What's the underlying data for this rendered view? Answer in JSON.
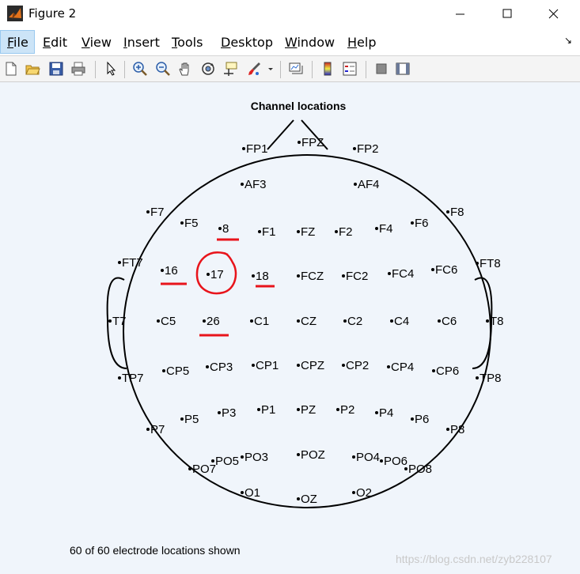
{
  "window": {
    "title": "Figure 2",
    "minimize_glyph": "—",
    "maximize_glyph": "☐",
    "close_glyph": "✕"
  },
  "menu": {
    "items": [
      "File",
      "Edit",
      "View",
      "Insert",
      "Tools",
      "Desktop",
      "Window",
      "Help"
    ],
    "undock_glyph": "↘"
  },
  "toolbar": {
    "icons": [
      "new-figure-icon",
      "open-file-icon",
      "save-icon",
      "print-icon",
      "select-arrow-icon",
      "zoom-in-icon",
      "zoom-out-icon",
      "pan-hand-icon",
      "rotate-3d-icon",
      "data-cursor-icon",
      "brush-icon",
      "brush-dropdown-icon",
      "link-plot-icon",
      "colorbar-icon",
      "legend-icon",
      "hide-plot-tools-icon",
      "show-plot-tools-icon"
    ]
  },
  "plot": {
    "title": "Channel locations",
    "footer": "60 of 60 electrode locations shown",
    "electrodes": [
      "FP1",
      "FPZ",
      "FP2",
      "AF3",
      "AF4",
      "F7",
      "F5",
      "8",
      "F1",
      "FZ",
      "F2",
      "F4",
      "F6",
      "F8",
      "FT7",
      "16",
      "17",
      "18",
      "FCZ",
      "FC2",
      "FC4",
      "FC6",
      "FT8",
      "T7",
      "C5",
      "26",
      "C1",
      "CZ",
      "C2",
      "C4",
      "C6",
      "T8",
      "TP7",
      "CP5",
      "CP3",
      "CP1",
      "CPZ",
      "CP2",
      "CP4",
      "CP6",
      "TP8",
      "P7",
      "P5",
      "P3",
      "P1",
      "PZ",
      "P2",
      "P4",
      "P6",
      "P8",
      "PO7",
      "PO5",
      "PO3",
      "POZ",
      "PO4",
      "PO6",
      "PO8",
      "O1",
      "OZ",
      "O2"
    ],
    "annotation_color": "#e8141b"
  },
  "watermark": "https://blog.csdn.net/zyb228107"
}
